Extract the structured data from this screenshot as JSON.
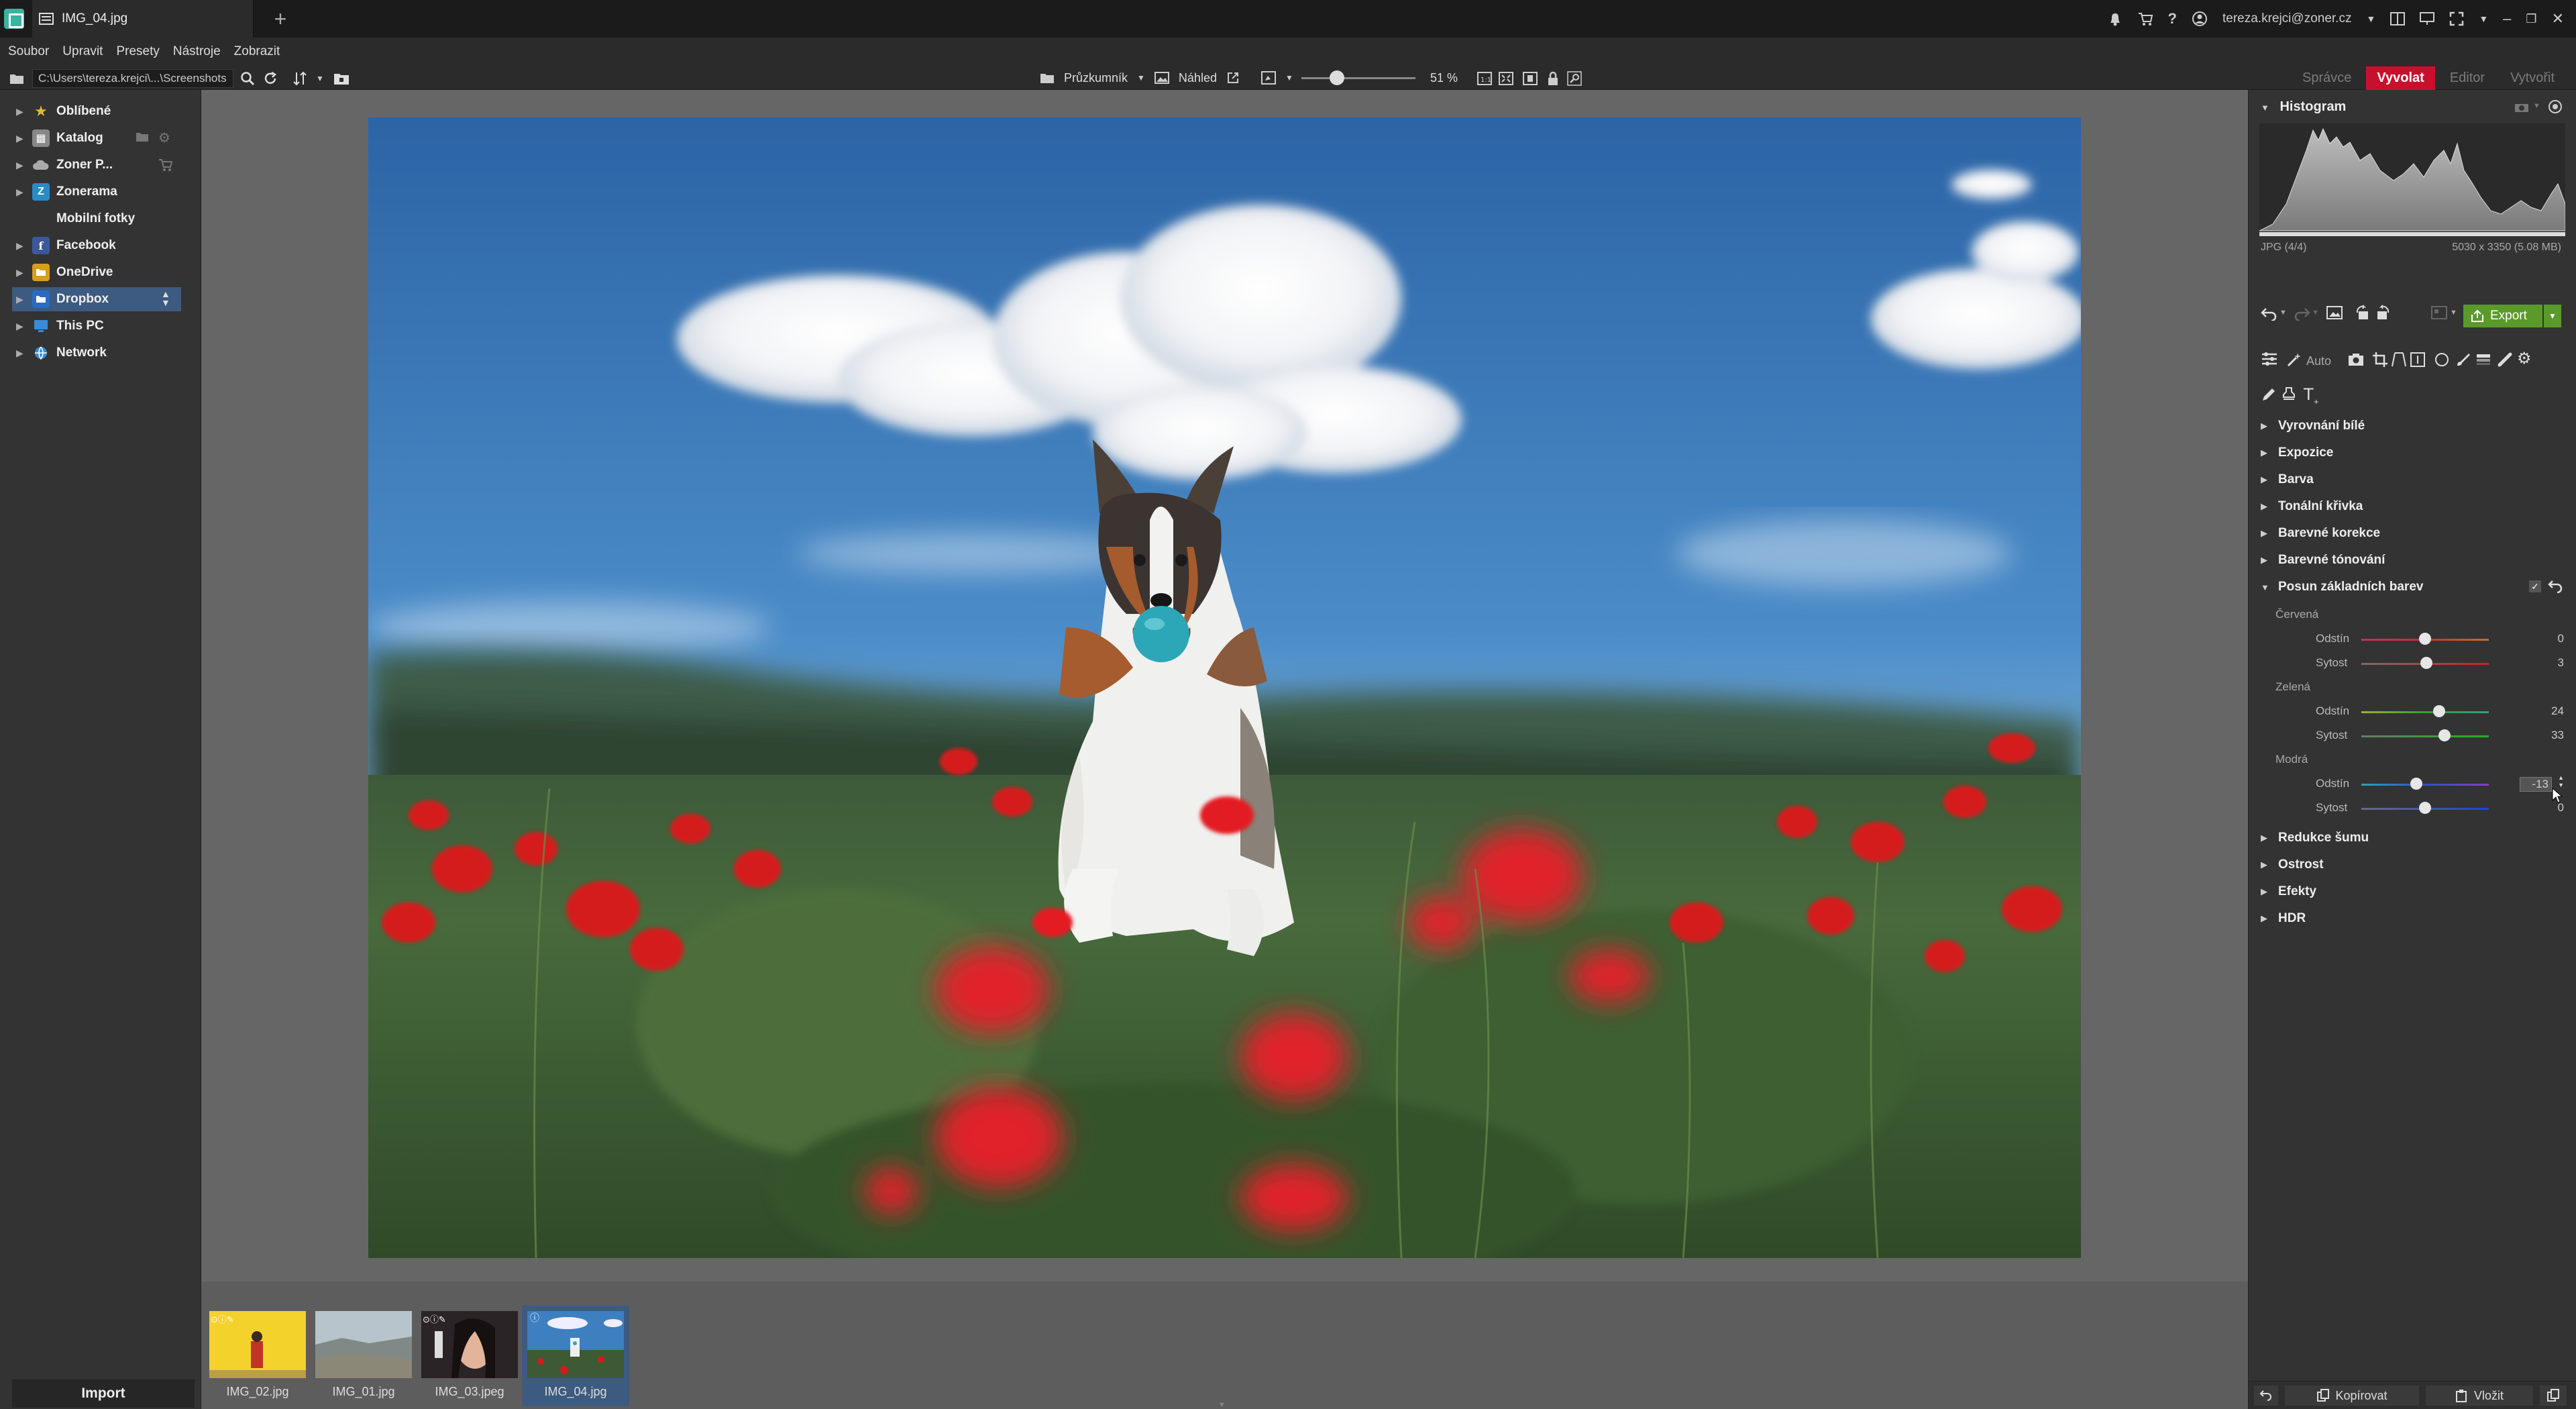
{
  "window": {
    "tab_title": "IMG_04.jpg",
    "user": "tereza.krejci@zoner.cz"
  },
  "menu": [
    "Soubor",
    "Upravit",
    "Presety",
    "Nástroje",
    "Zobrazit"
  ],
  "toolbar": {
    "path": "C:\\Users\\tereza.krejci\\...\\Screenshots",
    "browser_label": "Průzkumník",
    "preview_label": "Náhled",
    "zoom": "51 %",
    "zoom_level": 0.51
  },
  "modes": [
    "Správce",
    "Vyvolat",
    "Editor",
    "Vytvořit"
  ],
  "active_mode": "Vyvolat",
  "nav": [
    {
      "label": "Oblíbené",
      "icon": "star-icon",
      "color": "#c9a227"
    },
    {
      "label": "Katalog",
      "icon": "catalog-icon",
      "color": "#888888"
    },
    {
      "label": "Zoner P...",
      "icon": "cloud-icon",
      "color": "#999999"
    },
    {
      "label": "Zonerama",
      "icon": "zonerama-icon",
      "color": "#2a8cc4"
    },
    {
      "label": "Mobilní fotky",
      "icon": "",
      "color": ""
    },
    {
      "label": "Facebook",
      "icon": "facebook-icon",
      "color": "#3b5998"
    },
    {
      "label": "OneDrive",
      "icon": "onedrive-icon",
      "color": "#d4a017"
    },
    {
      "label": "Dropbox",
      "icon": "dropbox-icon",
      "color": "#2a6cc4"
    },
    {
      "label": "This PC",
      "icon": "pc-icon",
      "color": "#3a8ad6"
    },
    {
      "label": "Network",
      "icon": "network-icon",
      "color": "#3a8ad6"
    }
  ],
  "import_label": "Import",
  "filmstrip": [
    {
      "label": "IMG_02.jpg"
    },
    {
      "label": "IMG_01.jpg"
    },
    {
      "label": "IMG_03.jpeg"
    },
    {
      "label": "IMG_04.jpg"
    }
  ],
  "right": {
    "histogram_title": "Histogram",
    "format": "JPG (4/4)",
    "size": "5030 x 3350 (5.08 MB)",
    "export_label": "Export",
    "auto_label": "Auto",
    "sections_top": [
      "Vyrovnání bílé",
      "Expozice",
      "Barva",
      "Tonální křivka",
      "Barevné korekce",
      "Barevné tónování"
    ],
    "open_section": "Posun základních barev",
    "groups": [
      {
        "name": "Červená",
        "rows": [
          {
            "label": "Odstín",
            "value": "0",
            "pos": 0.5
          },
          {
            "label": "Sytost",
            "value": "3",
            "pos": 0.51
          }
        ]
      },
      {
        "name": "Zelená",
        "rows": [
          {
            "label": "Odstín",
            "value": "24",
            "pos": 0.61
          },
          {
            "label": "Sytost",
            "value": "33",
            "pos": 0.65
          }
        ]
      },
      {
        "name": "Modrá",
        "rows": [
          {
            "label": "Odstín",
            "value": "-13",
            "pos": 0.43
          },
          {
            "label": "Sytost",
            "value": "0",
            "pos": 0.5
          }
        ]
      }
    ],
    "sections_bottom": [
      "Redukce šumu",
      "Ostrost",
      "Efekty",
      "HDR"
    ],
    "copy_label": "Kopírovat",
    "paste_label": "Vložit"
  }
}
